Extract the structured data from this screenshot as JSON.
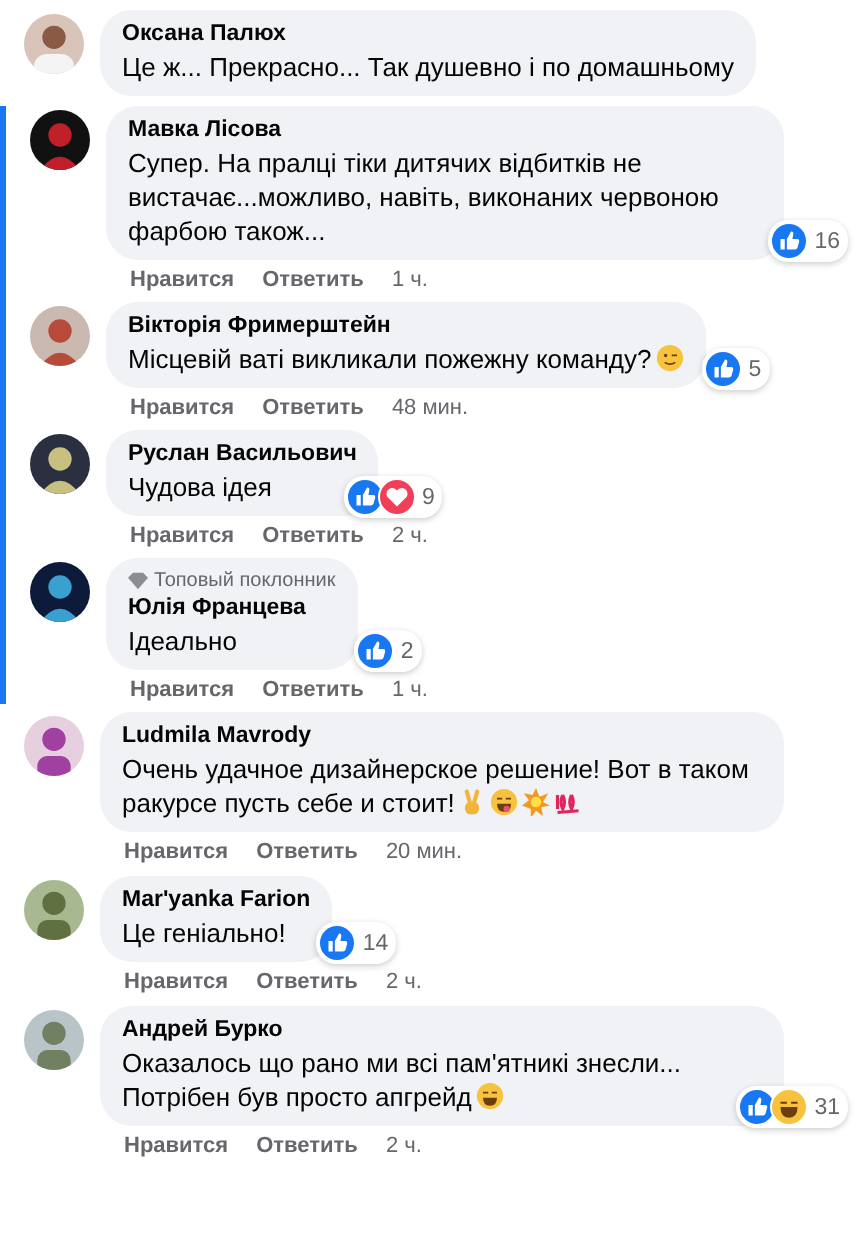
{
  "thread": {
    "comment": {
      "name": "Оксана Палюх",
      "text": "Це ж... Прекрасно... Так душевно і по домашньому"
    },
    "replies": [
      {
        "name": "Мавка Лісова",
        "text": "Супер. На пралці тіки дитячих відбитків не вистачає...можливо, навіть, виконаних червоною фарбою також...",
        "reactions": [
          {
            "kind": "like"
          }
        ],
        "reaction_count": "16",
        "actions": [
          "Нравится",
          "Ответить",
          "1 ч."
        ]
      },
      {
        "name": "Вікторія Фримерштейн",
        "text": "Місцевій ваті викликали пожежну команду?",
        "emojis": [
          {
            "kind": "wink"
          }
        ],
        "reactions": [
          {
            "kind": "like"
          }
        ],
        "reaction_count": "5",
        "actions": [
          "Нравится",
          "Ответить",
          "48 мин."
        ]
      },
      {
        "name": "Руслан Васильович",
        "text": "Чудова ідея",
        "reactions": [
          {
            "kind": "like"
          },
          {
            "kind": "love"
          }
        ],
        "reaction_count": "9",
        "actions": [
          "Нравится",
          "Ответить",
          "2 ч."
        ]
      },
      {
        "badge": "Топовый поклонник",
        "name": "Юлія Францева",
        "text": "Ідеально",
        "reactions": [
          {
            "kind": "like"
          }
        ],
        "reaction_count": "2",
        "actions": [
          "Нравится",
          "Ответить",
          "1 ч."
        ]
      }
    ]
  },
  "comments": [
    {
      "name": "Ludmila Mavrody",
      "text": "Очень удачное дизайнерское решение! Вот в таком ракурсе пусть себе и стоит!",
      "emojis": [
        {
          "kind": "victory"
        },
        {
          "kind": "tongue"
        },
        {
          "kind": "sparkle"
        },
        {
          "kind": "hundred"
        }
      ],
      "actions": [
        "Нравится",
        "Ответить",
        "20 мин."
      ]
    },
    {
      "name": "Mar'yanka Farion",
      "text": "Це геніально!",
      "reactions": [
        {
          "kind": "like"
        }
      ],
      "reaction_count": "14",
      "actions": [
        "Нравится",
        "Ответить",
        "2 ч."
      ]
    },
    {
      "name": "Андрей Бурко",
      "text": "Оказалось що рано ми всі пам'ятникі знесли... Потрібен був просто апгрейд",
      "emojis": [
        {
          "kind": "laugh"
        }
      ],
      "reactions": [
        {
          "kind": "like"
        },
        {
          "kind": "haha"
        }
      ],
      "reaction_count": "31",
      "actions": [
        "Нравится",
        "Ответить",
        "2 ч."
      ]
    }
  ]
}
